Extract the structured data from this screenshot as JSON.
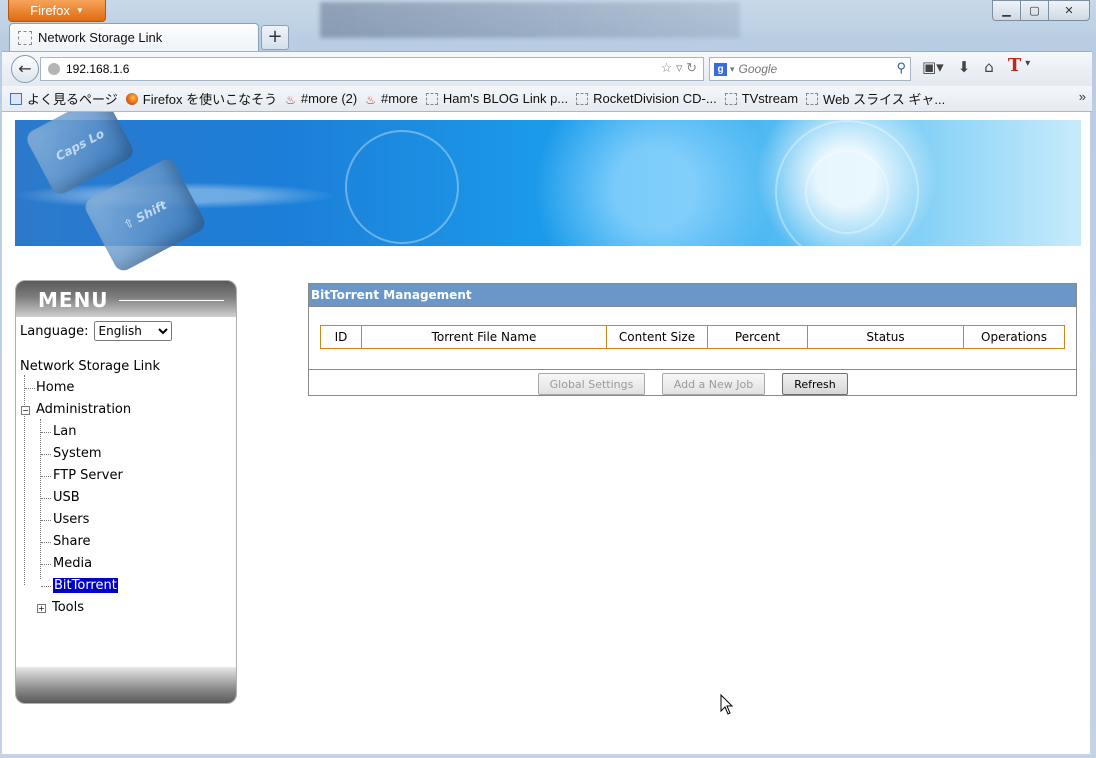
{
  "browser": {
    "app_button": "Firefox",
    "tab_title": "Network Storage Link",
    "url": "192.168.1.6",
    "search_placeholder": "Google",
    "bookmarks": [
      "よく見るページ",
      "Firefox を使いこなそう",
      "#more (2)",
      "#more",
      "Ham's BLOG Link p...",
      "RocketDivision  CD-...",
      "TVstream",
      "Web スライス ギャ..."
    ]
  },
  "menu": {
    "title": "MENU",
    "language_label": "Language:",
    "language_value": "English",
    "root": "Network Storage Link",
    "home": "Home",
    "administration": "Administration",
    "admin_items": [
      "Lan",
      "System",
      "FTP Server",
      "USB",
      "Users",
      "Share",
      "Media",
      "BitTorrent"
    ],
    "selected": "BitTorrent",
    "tools": "Tools"
  },
  "bittorrent": {
    "title": "BitTorrent Management",
    "columns": [
      "ID",
      "Torrent File Name",
      "Content Size",
      "Percent",
      "Status",
      "Operations"
    ],
    "buttons": {
      "global_settings": "Global Settings",
      "add_job": "Add a New Job",
      "refresh": "Refresh"
    }
  },
  "colors": {
    "header_bar": "#6a97c8",
    "table_border": "#c98a14",
    "selected_bg": "#0000cc",
    "tree_root": "#6f8fb8"
  }
}
